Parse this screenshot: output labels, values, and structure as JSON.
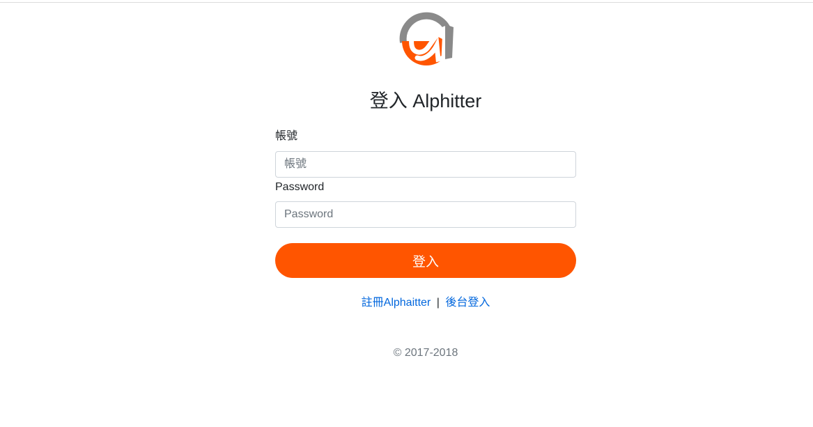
{
  "brand": {
    "logo_icon": "alpha-logo-icon",
    "accent_color": "#ff5500",
    "logo_ring_color": "#8a8a8a"
  },
  "login": {
    "title": "登入 Alphitter",
    "username_label": "帳號",
    "username_placeholder": "帳號",
    "password_label": "Password",
    "password_placeholder": "Password",
    "submit_label": "登入"
  },
  "links": {
    "register": "註冊Alphaitter",
    "separator": "|",
    "admin_login": "後台登入",
    "link_color": "#0066dd"
  },
  "footer": {
    "copyright": "© 2017-2018"
  }
}
